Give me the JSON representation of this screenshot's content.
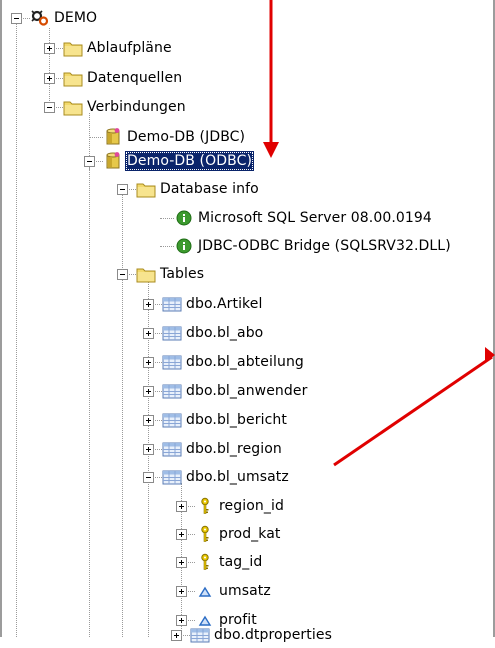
{
  "tree": {
    "nodes": [
      {
        "label": "DEMO",
        "icon": "project-gear-icon",
        "state": "expanded"
      },
      {
        "label": "Ablaufpläne",
        "icon": "folder-icon",
        "state": "collapsed"
      },
      {
        "label": "Datenquellen",
        "icon": "folder-icon",
        "state": "collapsed"
      },
      {
        "label": "Verbindungen",
        "icon": "folder-icon",
        "state": "expanded"
      },
      {
        "label": "Demo-DB (JDBC)",
        "icon": "database-icon",
        "state": "leaf"
      },
      {
        "label": "Demo-DB (ODBC)",
        "icon": "database-icon",
        "state": "expanded",
        "selected": true
      },
      {
        "label": "Database info",
        "icon": "folder-icon",
        "state": "expanded"
      },
      {
        "label": "Microsoft SQL Server 08.00.0194",
        "icon": "info-icon",
        "state": "leaf"
      },
      {
        "label": "JDBC-ODBC Bridge (SQLSRV32.DLL)",
        "icon": "info-icon",
        "state": "leaf"
      },
      {
        "label": "Tables",
        "icon": "folder-icon",
        "state": "expanded"
      },
      {
        "label": "dbo.Artikel",
        "icon": "table-icon",
        "state": "collapsed"
      },
      {
        "label": "dbo.bl_abo",
        "icon": "table-icon",
        "state": "collapsed"
      },
      {
        "label": "dbo.bl_abteilung",
        "icon": "table-icon",
        "state": "collapsed"
      },
      {
        "label": "dbo.bl_anwender",
        "icon": "table-icon",
        "state": "collapsed"
      },
      {
        "label": "dbo.bl_bericht",
        "icon": "table-icon",
        "state": "collapsed"
      },
      {
        "label": "dbo.bl_region",
        "icon": "table-icon",
        "state": "collapsed"
      },
      {
        "label": "dbo.bl_umsatz",
        "icon": "table-icon",
        "state": "expanded"
      },
      {
        "label": "region_id",
        "icon": "key-icon",
        "state": "collapsed"
      },
      {
        "label": "prod_kat",
        "icon": "key-icon",
        "state": "collapsed"
      },
      {
        "label": "tag_id",
        "icon": "key-icon",
        "state": "collapsed"
      },
      {
        "label": "umsatz",
        "icon": "measure-icon",
        "state": "collapsed"
      },
      {
        "label": "profit",
        "icon": "measure-icon",
        "state": "collapsed"
      },
      {
        "label": "dbo.dtproperties",
        "icon": "table-icon",
        "state": "collapsed"
      }
    ]
  },
  "colors": {
    "selection": "#0a246a",
    "selection_text": "#ffffff",
    "folder": "#f2d96b",
    "annotation_arrow": "#e00000",
    "info_icon": "#3c9a2e",
    "table_icon": "#9fbde6",
    "key_icon": "#e8c600",
    "measure_icon": "#2b6cc4"
  }
}
